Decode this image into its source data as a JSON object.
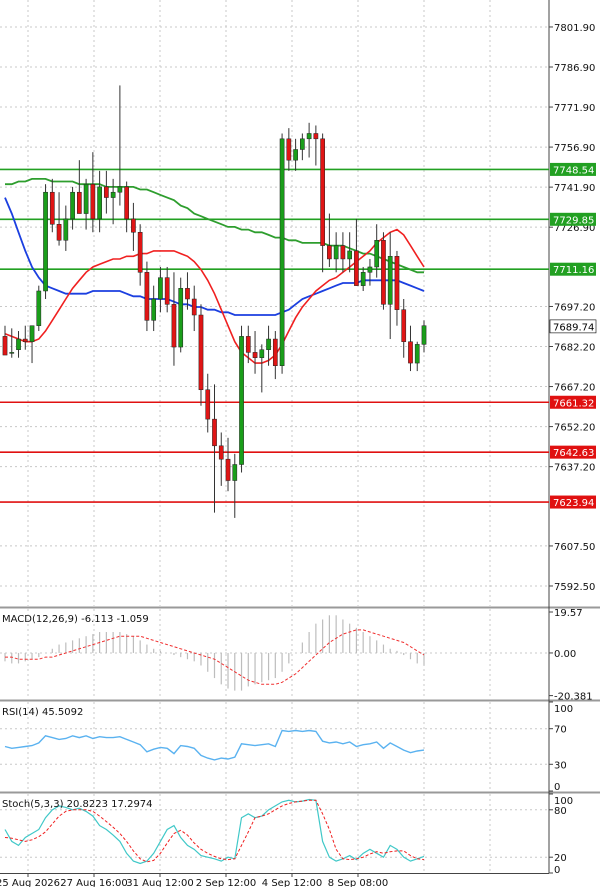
{
  "colors": {
    "up": "#1a9e1a",
    "down": "#e01515",
    "wick": "#333333",
    "ma_blue": "#1b3fe0",
    "ma_green": "#2e9e2e",
    "ma_red": "#f02020",
    "support": "#e01010",
    "resistance": "#22a022",
    "grid": "#c8c8c8",
    "macd_hist": "#bdbdbd",
    "macd_signal": "#f03030",
    "rsi": "#5ab2f0",
    "stoch_main": "#40c8c8",
    "stoch_signal": "#f02020"
  },
  "chart_data": [
    {
      "type": "candlestick",
      "panel": "price",
      "ylim": [
        7585,
        7812
      ],
      "y_ticks": [
        "7801.90",
        "7786.90",
        "7771.90",
        "7756.90",
        "7741.90",
        "7726.90",
        "7697.20",
        "7682.20",
        "7667.20",
        "7652.20",
        "7637.20",
        "7607.50",
        "7592.50"
      ],
      "last_price": "7689.74",
      "resistance_levels": [
        {
          "value": 7748.54,
          "label": "7748.54"
        },
        {
          "value": 7729.85,
          "label": "7729.85"
        },
        {
          "value": 7711.16,
          "label": "7711.16"
        }
      ],
      "support_levels": [
        {
          "value": 7661.32,
          "label": "7661.32"
        },
        {
          "value": 7642.63,
          "label": "7642.63"
        },
        {
          "value": 7623.94,
          "label": "7623.94"
        }
      ],
      "x_labels": [
        "25 Aug 2026",
        "27 Aug 16:00",
        "31 Aug 12:00",
        "2 Sep 12:00",
        "4 Sep 12:00",
        "8 Sep 08:00"
      ],
      "candles": [
        [
          7686,
          7690,
          7680,
          7679
        ],
        [
          7680,
          7689,
          7678,
          7680
        ],
        [
          7681,
          7688,
          7678,
          7685
        ],
        [
          7685,
          7690,
          7681,
          7684
        ],
        [
          7684,
          7690,
          7676,
          7690
        ],
        [
          7690,
          7705,
          7688,
          7703
        ],
        [
          7703,
          7743,
          7700,
          7740
        ],
        [
          7740,
          7745,
          7725,
          7728
        ],
        [
          7728,
          7740,
          7720,
          7722
        ],
        [
          7722,
          7735,
          7718,
          7730
        ],
        [
          7730,
          7742,
          7726,
          7740
        ],
        [
          7740,
          7752,
          7732,
          7732
        ],
        [
          7732,
          7745,
          7726,
          7743
        ],
        [
          7743,
          7755,
          7725,
          7730
        ],
        [
          7730,
          7748,
          7725,
          7742
        ],
        [
          7742,
          7748,
          7732,
          7738
        ],
        [
          7738,
          7745,
          7728,
          7740
        ],
        [
          7740,
          7780,
          7735,
          7742
        ],
        [
          7742,
          7744,
          7725,
          7730
        ],
        [
          7730,
          7736,
          7718,
          7725
        ],
        [
          7725,
          7728,
          7705,
          7710
        ],
        [
          7710,
          7714,
          7688,
          7692
        ],
        [
          7692,
          7705,
          7688,
          7700
        ],
        [
          7700,
          7712,
          7695,
          7708
        ],
        [
          7708,
          7712,
          7695,
          7698
        ],
        [
          7698,
          7710,
          7675,
          7682
        ],
        [
          7682,
          7708,
          7680,
          7704
        ],
        [
          7704,
          7710,
          7696,
          7700
        ],
        [
          7700,
          7705,
          7688,
          7694
        ],
        [
          7694,
          7698,
          7660,
          7666
        ],
        [
          7666,
          7672,
          7650,
          7655
        ],
        [
          7655,
          7668,
          7620,
          7645
        ],
        [
          7645,
          7650,
          7630,
          7640
        ],
        [
          7640,
          7648,
          7628,
          7632
        ],
        [
          7632,
          7642,
          7618,
          7638
        ],
        [
          7638,
          7690,
          7635,
          7686
        ],
        [
          7686,
          7690,
          7676,
          7680
        ],
        [
          7680,
          7688,
          7672,
          7678
        ],
        [
          7678,
          7683,
          7665,
          7681
        ],
        [
          7681,
          7690,
          7675,
          7685
        ],
        [
          7685,
          7688,
          7670,
          7675
        ],
        [
          7675,
          7762,
          7672,
          7760
        ],
        [
          7760,
          7764,
          7748,
          7752
        ],
        [
          7752,
          7760,
          7748,
          7756
        ],
        [
          7756,
          7762,
          7752,
          7760
        ],
        [
          7760,
          7766,
          7753,
          7762
        ],
        [
          7762,
          7765,
          7750,
          7760
        ],
        [
          7760,
          7762,
          7710,
          7720
        ],
        [
          7720,
          7732,
          7712,
          7715
        ],
        [
          7715,
          7725,
          7710,
          7720
        ],
        [
          7720,
          7725,
          7710,
          7715
        ],
        [
          7715,
          7725,
          7710,
          7718
        ],
        [
          7718,
          7730,
          7705,
          7705
        ],
        [
          7705,
          7712,
          7703,
          7710
        ],
        [
          7710,
          7715,
          7705,
          7712
        ],
        [
          7712,
          7728,
          7708,
          7722
        ],
        [
          7722,
          7725,
          7696,
          7698
        ],
        [
          7698,
          7725,
          7685,
          7716
        ],
        [
          7716,
          7718,
          7690,
          7696
        ],
        [
          7696,
          7700,
          7678,
          7684
        ],
        [
          7684,
          7690,
          7673,
          7676
        ],
        [
          7676,
          7684,
          7673,
          7683
        ],
        [
          7683,
          7692,
          7680,
          7690
        ]
      ],
      "ma_blue": [
        7738,
        7732,
        7725,
        7718,
        7712,
        7708,
        7705,
        7704,
        7703,
        7702,
        7702,
        7702,
        7702,
        7703,
        7703,
        7703,
        7703,
        7703,
        7702,
        7701,
        7701,
        7700,
        7700,
        7700,
        7700,
        7699,
        7698,
        7698,
        7697,
        7697,
        7696,
        7696,
        7695,
        7695,
        7694,
        7694,
        7694,
        7694,
        7694,
        7694,
        7694,
        7695,
        7696,
        7698,
        7700,
        7701,
        7702,
        7703,
        7704,
        7705,
        7706,
        7706,
        7706,
        7707,
        7707,
        7707,
        7707,
        7707,
        7707,
        7706,
        7705,
        7704,
        7703
      ],
      "ma_green": [
        7743,
        7743,
        7744,
        7744,
        7745,
        7745,
        7745,
        7744,
        7744,
        7744,
        7744,
        7743,
        7743,
        7743,
        7743,
        7742,
        7742,
        7742,
        7742,
        7742,
        7741,
        7741,
        7740,
        7739,
        7738,
        7737,
        7735,
        7734,
        7732,
        7731,
        7730,
        7729,
        7728,
        7727,
        7727,
        7726,
        7726,
        7725,
        7725,
        7724,
        7723,
        7723,
        7722,
        7722,
        7721,
        7721,
        7721,
        7721,
        7720,
        7720,
        7720,
        7719,
        7718,
        7717,
        7717,
        7716,
        7715,
        7714,
        7713,
        7712,
        7711,
        7710,
        7710
      ],
      "ma_red": [
        7687,
        7686,
        7685,
        7684,
        7684,
        7685,
        7688,
        7692,
        7696,
        7700,
        7704,
        7707,
        7710,
        7712,
        7713,
        7714,
        7715,
        7715,
        7716,
        7716,
        7717,
        7717,
        7718,
        7718,
        7718,
        7718,
        7717,
        7716,
        7714,
        7711,
        7707,
        7702,
        7696,
        7690,
        7684,
        7680,
        7678,
        7676,
        7676,
        7677,
        7679,
        7683,
        7688,
        7693,
        7697,
        7700,
        7703,
        7705,
        7707,
        7708,
        7710,
        7712,
        7714,
        7716,
        7718,
        7721,
        7723,
        7725,
        7726,
        7724,
        7720,
        7716,
        7712
      ]
    },
    {
      "type": "bar",
      "panel": "macd",
      "label": "MACD(12,26,9) -6.113 -1.059",
      "ylim": [
        -22,
        21
      ],
      "y_ticks": [
        "19.57",
        "0.00",
        "-20.381"
      ],
      "histogram": [
        -4,
        -5,
        -5,
        -4,
        -3,
        -2,
        0,
        2,
        4,
        5,
        6,
        7,
        8,
        9,
        10,
        10,
        10,
        10,
        9,
        8,
        6,
        4,
        2,
        1,
        0,
        -1,
        -2,
        -3,
        -4,
        -6,
        -9,
        -12,
        -15,
        -17,
        -18,
        -18,
        -16,
        -15,
        -14,
        -13,
        -12,
        -9,
        -5,
        0,
        5,
        10,
        14,
        16,
        18,
        18,
        16,
        14,
        12,
        10,
        8,
        6,
        4,
        2,
        1,
        -1,
        -3,
        -5,
        -6
      ],
      "signal": [
        -2,
        -2,
        -3,
        -3,
        -3,
        -3,
        -2,
        -2,
        -1,
        0,
        1,
        2,
        3,
        4,
        5,
        6,
        7,
        8,
        8,
        8,
        8,
        7,
        6,
        5,
        4,
        3,
        2,
        1,
        0,
        -1,
        -2,
        -3,
        -5,
        -7,
        -9,
        -11,
        -13,
        -14,
        -15,
        -15,
        -15,
        -14,
        -12,
        -10,
        -7,
        -4,
        -1,
        2,
        5,
        7,
        9,
        10,
        11,
        11,
        10,
        9,
        8,
        7,
        6,
        5,
        3,
        1,
        -1
      ]
    },
    {
      "type": "line",
      "panel": "rsi",
      "label": "RSI(14) 45.5092",
      "ylim": [
        0,
        100
      ],
      "y_ticks": [
        "100",
        "70",
        "30",
        "0"
      ],
      "series": [
        {
          "values": [
            50,
            48,
            49,
            50,
            51,
            54,
            62,
            60,
            58,
            59,
            62,
            60,
            62,
            59,
            61,
            60,
            60,
            61,
            58,
            55,
            52,
            44,
            47,
            49,
            48,
            42,
            51,
            50,
            48,
            40,
            37,
            35,
            37,
            36,
            38,
            53,
            52,
            51,
            52,
            53,
            50,
            68,
            67,
            68,
            67,
            68,
            67,
            56,
            54,
            55,
            53,
            55,
            50,
            52,
            53,
            55,
            48,
            54,
            50,
            46,
            43,
            45,
            46
          ]
        }
      ]
    },
    {
      "type": "line",
      "panel": "stochastic",
      "label": "Stoch(5,3,3) 20.8223 17.2974",
      "ylim": [
        0,
        100
      ],
      "y_ticks": [
        "100",
        "80",
        "20",
        "0"
      ],
      "series": [
        {
          "values": [
            55,
            40,
            35,
            45,
            50,
            55,
            70,
            80,
            85,
            83,
            80,
            82,
            78,
            72,
            60,
            55,
            48,
            40,
            25,
            15,
            12,
            15,
            25,
            40,
            55,
            60,
            45,
            35,
            30,
            22,
            20,
            18,
            15,
            20,
            18,
            70,
            75,
            70,
            72,
            80,
            85,
            90,
            92,
            90,
            91,
            93,
            92,
            40,
            20,
            15,
            18,
            22,
            17,
            25,
            30,
            25,
            20,
            35,
            30,
            20,
            15,
            18,
            21
          ]
        },
        {
          "values": [
            45,
            44,
            42,
            40,
            42,
            46,
            52,
            62,
            72,
            78,
            80,
            80,
            80,
            78,
            72,
            65,
            58,
            50,
            40,
            28,
            18,
            14,
            16,
            25,
            38,
            50,
            54,
            48,
            38,
            30,
            25,
            21,
            18,
            17,
            18,
            35,
            52,
            70,
            72,
            75,
            80,
            85,
            88,
            90,
            91,
            92,
            92,
            75,
            55,
            30,
            18,
            17,
            18,
            20,
            24,
            27,
            25,
            27,
            28,
            28,
            22,
            18,
            17
          ]
        }
      ]
    }
  ]
}
